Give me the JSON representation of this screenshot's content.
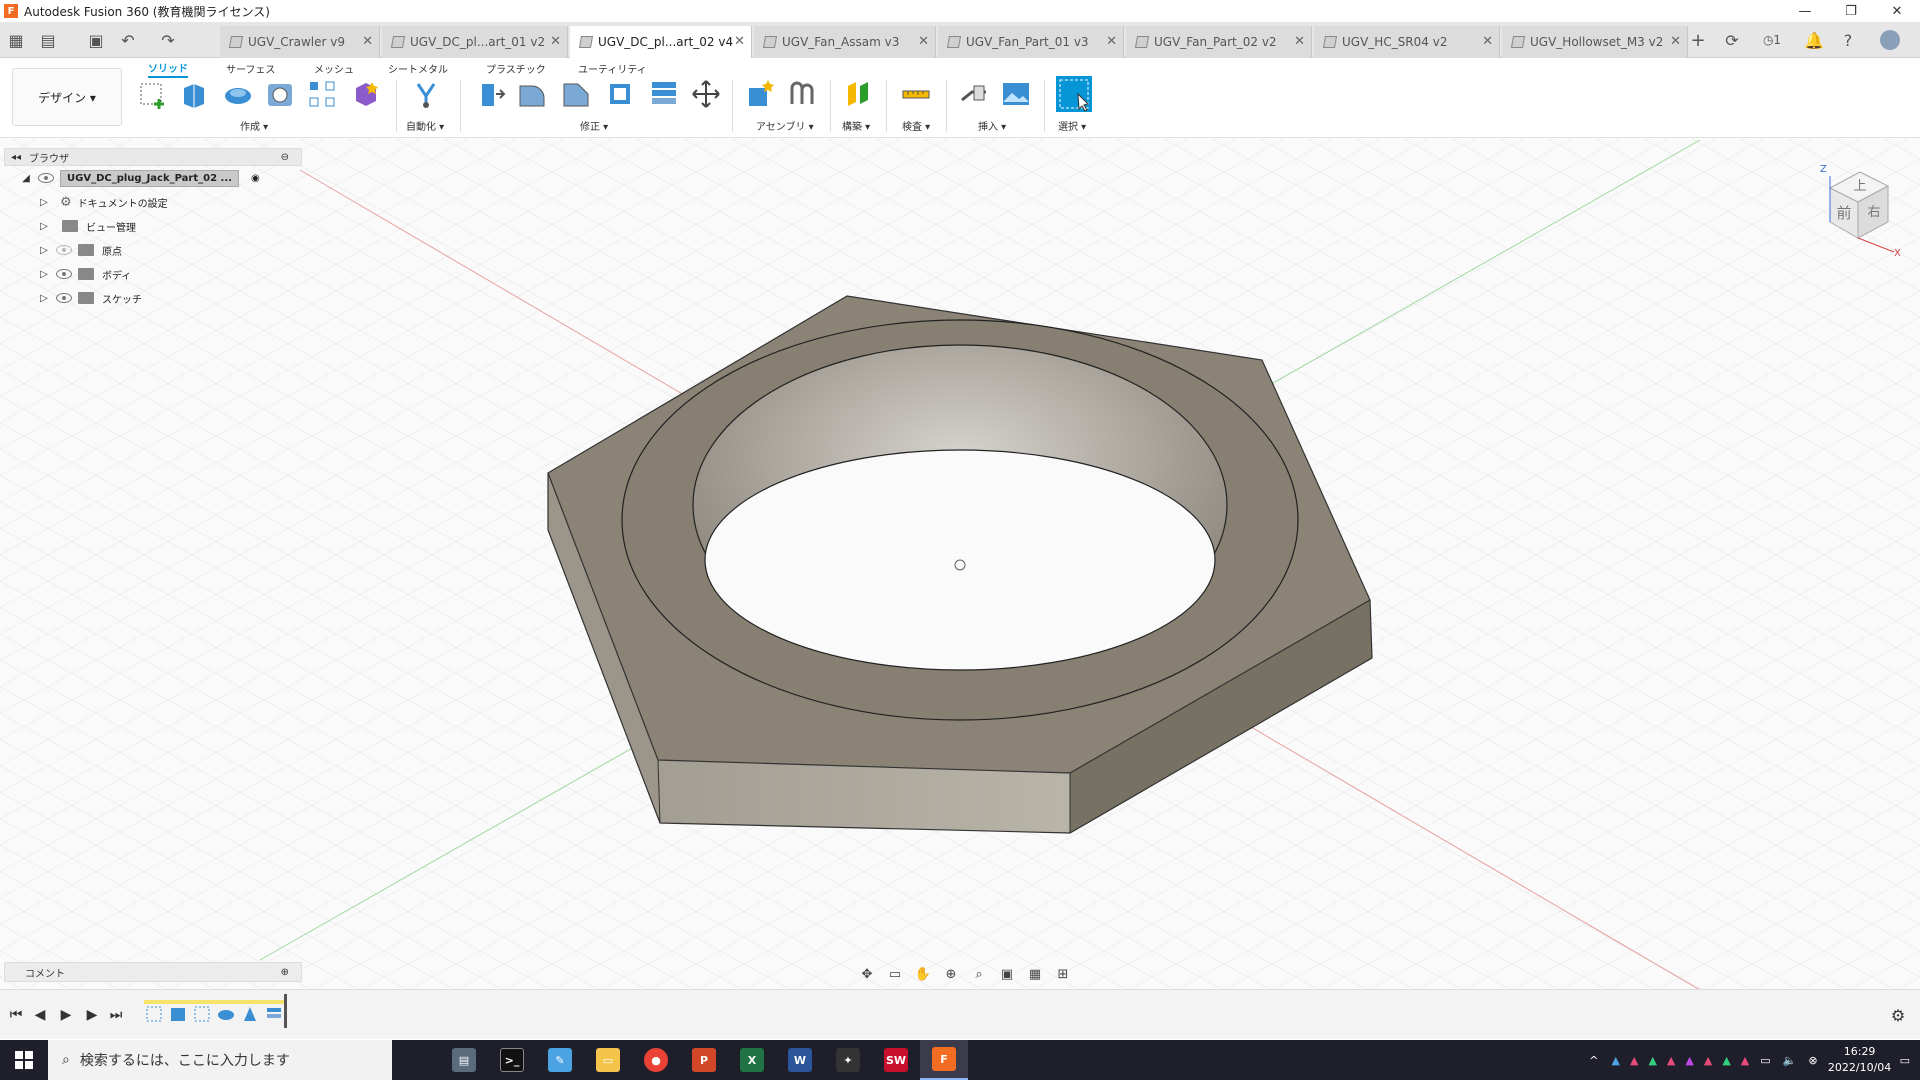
{
  "window": {
    "title": "Autodesk Fusion 360 (教育機関ライセンス)",
    "minimize": "—",
    "restore": "❐",
    "close": "✕"
  },
  "tabs": [
    {
      "label": "UGV_Crawler v9",
      "active": false
    },
    {
      "label": "UGV_DC_pl...art_01 v2",
      "active": false
    },
    {
      "label": "UGV_DC_pl...art_02 v4",
      "active": true
    },
    {
      "label": "UGV_Fan_Assam v3",
      "active": false
    },
    {
      "label": "UGV_Fan_Part_01 v3",
      "active": false
    },
    {
      "label": "UGV_Fan_Part_02 v2",
      "active": false
    },
    {
      "label": "UGV_HC_SR04 v2",
      "active": false
    },
    {
      "label": "UGV_Hollowset_M3 v2",
      "active": false
    }
  ],
  "tabbar_right": {
    "job_count": "1"
  },
  "toolbar": {
    "workspace": "デザイン ▾",
    "ws_tabs": [
      "ソリッド",
      "サーフェス",
      "メッシュ",
      "シートメタル",
      "プラスチック",
      "ユーティリティ"
    ],
    "groups": [
      "作成 ▾",
      "自動化 ▾",
      "修正 ▾",
      "アセンブリ ▾",
      "構築 ▾",
      "検査 ▾",
      "挿入 ▾",
      "選択 ▾"
    ]
  },
  "browser": {
    "title": "ブラウザ",
    "root": "UGV_DC_plug_Jack_Part_02 ...",
    "items": [
      "ドキュメントの設定",
      "ビュー管理",
      "原点",
      "ボディ",
      "スケッチ"
    ]
  },
  "viewcube": {
    "top": "上",
    "front": "前",
    "right": "右",
    "axis_z": "Z",
    "axis_x": "X"
  },
  "comments": {
    "label": "コメント"
  },
  "taskbar": {
    "search_placeholder": "検索するには、ここに入力します",
    "time": "16:29",
    "date": "2022/10/04"
  },
  "colors": {
    "accent": "#0696d7",
    "grid_red": "#e06666",
    "grid_green": "#66cc66",
    "nut_face": "#8a8376"
  }
}
